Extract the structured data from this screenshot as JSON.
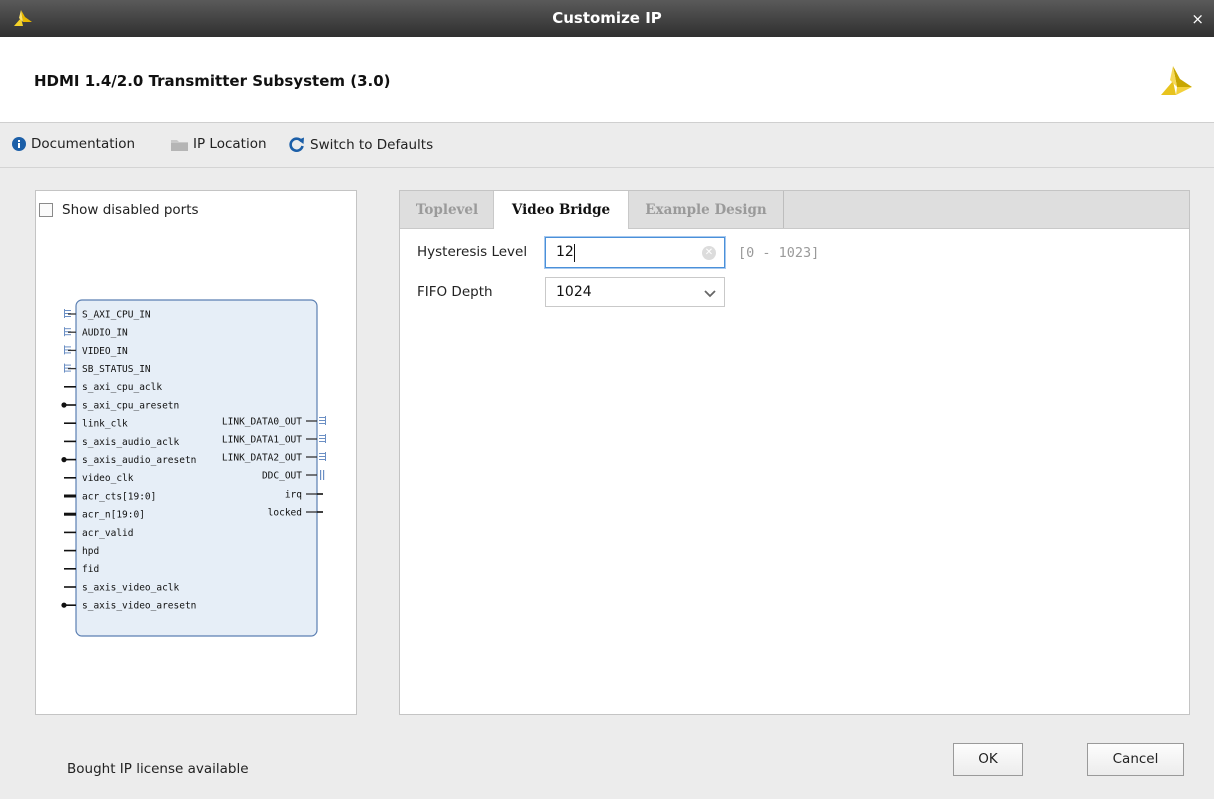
{
  "window": {
    "title": "Customize IP",
    "close_glyph": "×",
    "icon": "xilinx-logo-icon"
  },
  "header": {
    "ip_name": "HDMI 1.4/2.0 Transmitter Subsystem (3.0)",
    "logo": "xilinx-logo"
  },
  "toolbar": {
    "documentation_label": "Documentation",
    "ip_location_label": "IP Location",
    "switch_defaults_label": "Switch to Defaults"
  },
  "left_panel": {
    "show_disabled_ports_label": "Show disabled ports",
    "show_disabled_ports_checked": false,
    "block": {
      "left_ports": [
        {
          "label": "S_AXI_CPU_IN",
          "kind": "bus"
        },
        {
          "label": "AUDIO_IN",
          "kind": "bus"
        },
        {
          "label": "VIDEO_IN",
          "kind": "bus"
        },
        {
          "label": "SB_STATUS_IN",
          "kind": "bus"
        },
        {
          "label": "s_axi_cpu_aclk",
          "kind": "wire"
        },
        {
          "label": "s_axi_cpu_aresetn",
          "kind": "inverted"
        },
        {
          "label": "link_clk",
          "kind": "wire"
        },
        {
          "label": "s_axis_audio_aclk",
          "kind": "wire"
        },
        {
          "label": "s_axis_audio_aresetn",
          "kind": "inverted"
        },
        {
          "label": "video_clk",
          "kind": "wire"
        },
        {
          "label": "acr_cts[19:0]",
          "kind": "vector"
        },
        {
          "label": "acr_n[19:0]",
          "kind": "vector"
        },
        {
          "label": "acr_valid",
          "kind": "wire"
        },
        {
          "label": "hpd",
          "kind": "wire"
        },
        {
          "label": "fid",
          "kind": "wire"
        },
        {
          "label": "s_axis_video_aclk",
          "kind": "wire"
        },
        {
          "label": "s_axis_video_aresetn",
          "kind": "inverted"
        }
      ],
      "right_ports": [
        {
          "label": "LINK_DATA0_OUT",
          "kind": "bus"
        },
        {
          "label": "LINK_DATA1_OUT",
          "kind": "bus"
        },
        {
          "label": "LINK_DATA2_OUT",
          "kind": "bus"
        },
        {
          "label": "DDC_OUT",
          "kind": "iface"
        },
        {
          "label": "irq",
          "kind": "wire"
        },
        {
          "label": "locked",
          "kind": "wire"
        }
      ]
    }
  },
  "tabs": [
    {
      "label": "Toplevel",
      "active": false
    },
    {
      "label": "Video Bridge",
      "active": true
    },
    {
      "label": "Example Design",
      "active": false
    }
  ],
  "video_bridge": {
    "hysteresis_label": "Hysteresis Level",
    "hysteresis_value": "12",
    "hysteresis_range": "[0 - 1023]",
    "fifo_label": "FIFO Depth",
    "fifo_value": "1024"
  },
  "footer": {
    "license_text": "Bought IP license available",
    "ok_label": "OK",
    "cancel_label": "Cancel"
  },
  "colors": {
    "titlebar": "#3f3f3f",
    "block_fill": "#e6eef7",
    "block_border": "#5b7fb2",
    "focus_border": "#4a90d9",
    "xilinx_logo": "#f6d329"
  }
}
